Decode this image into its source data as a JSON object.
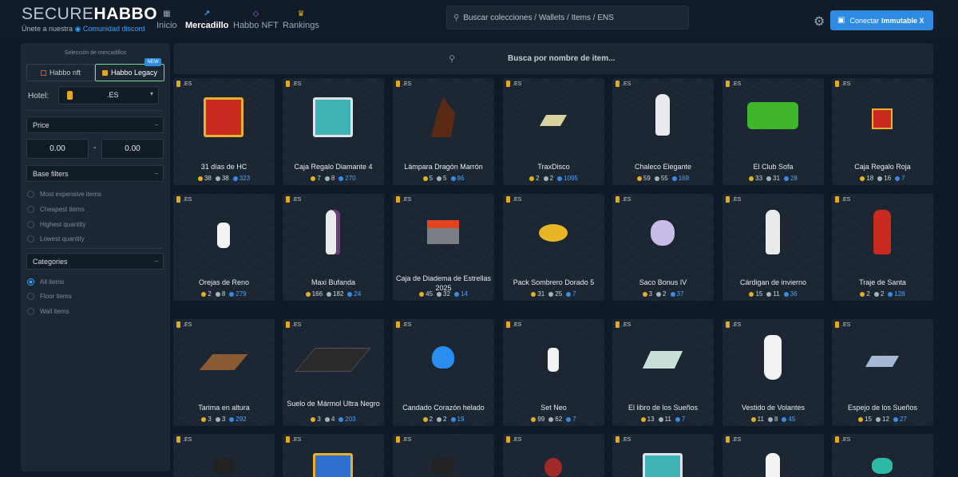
{
  "brand": {
    "part1": "SECURE",
    "part2": "HABBO",
    "subtitle": "Únete a nuestra",
    "discord": "Comunidad discord"
  },
  "nav": [
    {
      "label": "Inicio",
      "icon": "home-icon"
    },
    {
      "label": "Mercadillo",
      "icon": "chart-icon",
      "active": true
    },
    {
      "label": "Habbo NFT",
      "icon": "diamond-icon"
    },
    {
      "label": "Rankings",
      "icon": "crown-icon"
    }
  ],
  "search": {
    "placeholder": "Buscar colecciones / Wallets / Items / ENS"
  },
  "connect": {
    "prefix": "Conectar",
    "strong": "Immutable X"
  },
  "sidebar": {
    "title": "Selección de mercadillos",
    "markets": [
      {
        "label": "Habbo nft"
      },
      {
        "label": "Habbo Legacy",
        "active": true
      }
    ],
    "new_badge": "NEW",
    "hotel_label": "Hotel:",
    "hotel_value": ".ES",
    "price_label": "Price",
    "price_min": "0.00",
    "price_max": "0.00",
    "dash": "-",
    "base_filters_label": "Base filters",
    "base_filters": [
      "Most expensive items",
      "Cheapest items",
      "Highest quantity",
      "Lowest quantity"
    ],
    "categories_label": "Categories",
    "categories": [
      "All items",
      "Floor items",
      "Wall items"
    ],
    "categories_selected": "All items"
  },
  "item_search": {
    "placeholder": "Busca por nombre de item..."
  },
  "hotel_tag": ".ES",
  "items": [
    {
      "name": "31 días de HC",
      "gold": "38",
      "silver": "38",
      "blue": "323",
      "icon": "red-gift-box-icon"
    },
    {
      "name": "Caja Regalo Diamante 4",
      "gold": "7",
      "silver": "8",
      "blue": "270",
      "icon": "teal-gift-box-icon"
    },
    {
      "name": "Lámpara Dragón Marrón",
      "gold": "5",
      "silver": "5",
      "blue": "86",
      "icon": "dragon-lamp-icon"
    },
    {
      "name": "TraxDisco",
      "gold": "2",
      "silver": "2",
      "blue": "1095",
      "icon": "trax-disco-icon"
    },
    {
      "name": "Chaleco Elegante",
      "gold": "59",
      "silver": "55",
      "blue": "169",
      "icon": "mannequin-icon"
    },
    {
      "name": "El Club Sofa",
      "gold": "33",
      "silver": "31",
      "blue": "28",
      "icon": "green-sofa-icon"
    },
    {
      "name": "Caja Regalo Roja",
      "gold": "18",
      "silver": "16",
      "blue": "7",
      "icon": "small-red-gift-icon"
    },
    {
      "name": "Orejas de Reno",
      "gold": "2",
      "silver": "8",
      "blue": "279",
      "icon": "reindeer-ears-icon"
    },
    {
      "name": "Maxi Bufanda",
      "gold": "166",
      "silver": "182",
      "blue": "24",
      "icon": "mannequin-scarf-icon"
    },
    {
      "name": "Caja de Diadema de Estrellas 2025",
      "gold": "45",
      "silver": "32",
      "blue": "14",
      "icon": "diadem-box-icon"
    },
    {
      "name": "Pack Sombrero Dorado 5",
      "gold": "31",
      "silver": "25",
      "blue": "7",
      "icon": "golden-hat-icon"
    },
    {
      "name": "Saco Bonus IV",
      "gold": "3",
      "silver": "2",
      "blue": "37",
      "icon": "bonus-bag-icon"
    },
    {
      "name": "Cárdigan de invierno",
      "gold": "15",
      "silver": "11",
      "blue": "36",
      "icon": "mannequin-cardigan-icon"
    },
    {
      "name": "Traje de Santa",
      "gold": "2",
      "silver": "2",
      "blue": "128",
      "icon": "santa-suit-icon"
    },
    {
      "name": "Tarima en altura",
      "gold": "3",
      "silver": "3",
      "blue": "292",
      "icon": "wood-platform-icon"
    },
    {
      "name": "Suelo de Mármol Ultra Negro",
      "gold": "3",
      "silver": "4",
      "blue": "203",
      "icon": "black-floor-icon"
    },
    {
      "name": "Candado Corazón helado",
      "gold": "2",
      "silver": "2",
      "blue": "19",
      "icon": "ice-heart-lock-icon"
    },
    {
      "name": "Set Neo",
      "gold": "99",
      "silver": "62",
      "blue": "7",
      "icon": "neo-set-icon"
    },
    {
      "name": "El libro de los Sueños",
      "gold": "13",
      "silver": "11",
      "blue": "7",
      "icon": "dream-book-icon"
    },
    {
      "name": "Vestido de Volantes",
      "gold": "11",
      "silver": "8",
      "blue": "45",
      "icon": "mannequin-dress-icon"
    },
    {
      "name": "Espejo de los Sueños",
      "gold": "15",
      "silver": "12",
      "blue": "27",
      "icon": "dream-mirror-icon"
    },
    {
      "name": "",
      "icon": "item-icon"
    },
    {
      "name": "",
      "icon": "blue-gift-box-icon"
    },
    {
      "name": "",
      "icon": "item-icon"
    },
    {
      "name": "",
      "icon": "red-hair-bust-icon"
    },
    {
      "name": "",
      "icon": "teal-gift-box-icon"
    },
    {
      "name": "",
      "icon": "halo-mannequin-icon"
    },
    {
      "name": "",
      "icon": "teal-ornament-icon"
    }
  ]
}
